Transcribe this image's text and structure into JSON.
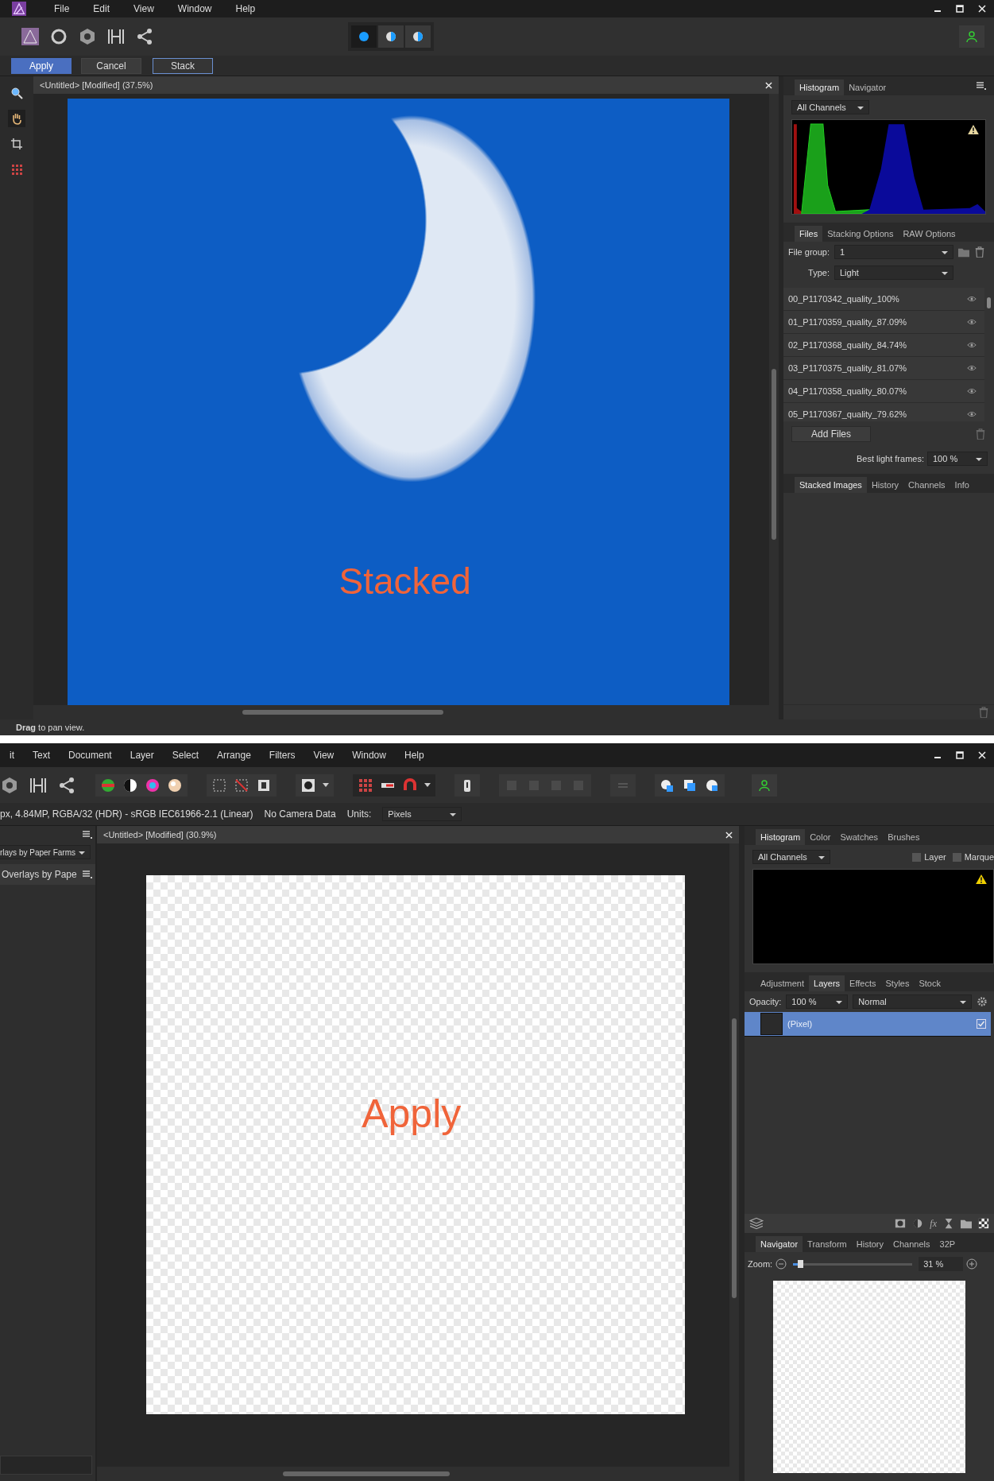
{
  "top": {
    "menu": [
      "File",
      "Edit",
      "View",
      "Window",
      "Help"
    ],
    "view_modes": [
      {
        "selected": true
      },
      {
        "selected": false
      },
      {
        "selected": false
      }
    ],
    "context_buttons": [
      {
        "label": "Apply",
        "kind": "primary"
      },
      {
        "label": "Cancel",
        "kind": "plain"
      },
      {
        "label": "Stack",
        "kind": "outline"
      }
    ],
    "document": {
      "title": "<Untitled> [Modified] (37.5%)",
      "annotation": "Stacked"
    },
    "histogram_panel": {
      "tabs": [
        {
          "label": "Histogram",
          "selected": true
        },
        {
          "label": "Navigator",
          "selected": false
        }
      ],
      "channels": "All Channels"
    },
    "files_panel": {
      "tabs": [
        {
          "label": "Files",
          "selected": true
        },
        {
          "label": "Stacking Options",
          "selected": false
        },
        {
          "label": "RAW Options",
          "selected": false
        }
      ],
      "file_group_label": "File group:",
      "file_group": "1",
      "type_label": "Type:",
      "type": "Light",
      "files": [
        "00_P1170342_quality_100%",
        "01_P1170359_quality_87.09%",
        "02_P1170368_quality_84.74%",
        "03_P1170375_quality_81.07%",
        "04_P1170358_quality_80.07%",
        "05_P1170367_quality_79.62%"
      ],
      "add_files": "Add Files",
      "best_frames_label": "Best light frames:",
      "best_frames": "100 %"
    },
    "lower_tabs": [
      {
        "label": "Stacked Images",
        "selected": true
      },
      {
        "label": "History",
        "selected": false
      },
      {
        "label": "Channels",
        "selected": false
      },
      {
        "label": "Info",
        "selected": false
      }
    ],
    "status": "**Drag** to pan view."
  },
  "bottom": {
    "menu": [
      "it",
      "Text",
      "Document",
      "Layer",
      "Select",
      "Arrange",
      "Filters",
      "View",
      "Window",
      "Help"
    ],
    "doc_info": "px, 4.84MP, RGBA/32 (HDR) - sRGB IEC61966-2.1 (Linear)",
    "camera": "No Camera Data",
    "units_label": "Units:",
    "units": "Pixels",
    "left_panel": {
      "source": "rlays by Paper Farms",
      "heading": "Overlays by Pape"
    },
    "document": {
      "title": "<Untitled> [Modified] (30.9%)",
      "annotation": "Apply"
    },
    "histogram_panel": {
      "tabs": [
        {
          "label": "Histogram",
          "selected": true
        },
        {
          "label": "Color",
          "selected": false
        },
        {
          "label": "Swatches",
          "selected": false
        },
        {
          "label": "Brushes",
          "selected": false
        }
      ],
      "channels": "All Channels",
      "options": [
        {
          "label": "Layer",
          "checked": false
        },
        {
          "label": "Marque",
          "checked": false
        }
      ]
    },
    "layers_panel": {
      "tabs": [
        {
          "label": "Adjustment",
          "selected": false
        },
        {
          "label": "Layers",
          "selected": true
        },
        {
          "label": "Effects",
          "selected": false
        },
        {
          "label": "Styles",
          "selected": false
        },
        {
          "label": "Stock",
          "selected": false
        }
      ],
      "opacity_label": "Opacity:",
      "opacity": "100 %",
      "blend": "Normal",
      "layers": [
        {
          "name": "(Pixel)",
          "selected": true,
          "visible": true
        }
      ],
      "effects_label": "fx"
    },
    "navigator_panel": {
      "tabs": [
        {
          "label": "Navigator",
          "selected": true
        },
        {
          "label": "Transform",
          "selected": false
        },
        {
          "label": "History",
          "selected": false
        },
        {
          "label": "Channels",
          "selected": false
        },
        {
          "label": "32P",
          "selected": false
        }
      ],
      "zoom_label": "Zoom:",
      "zoom": {
        "level": 0.06
      },
      "zoom_value": "31 %"
    }
  }
}
